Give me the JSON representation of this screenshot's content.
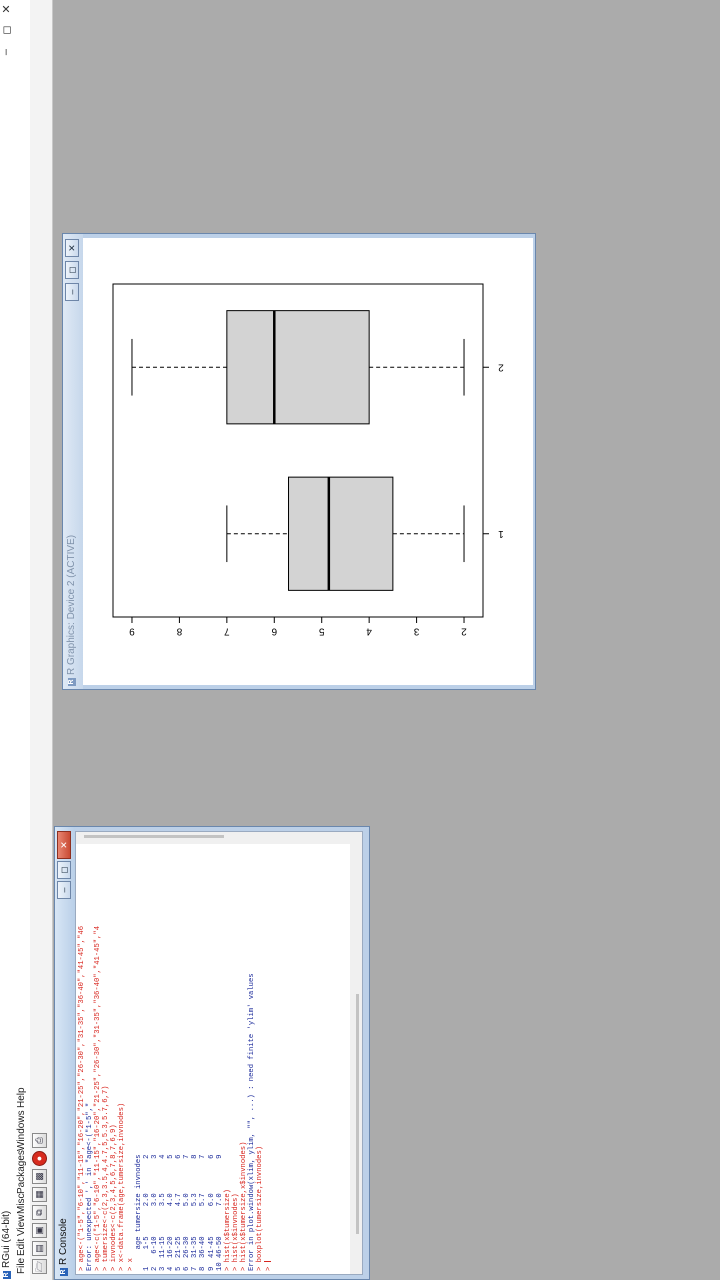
{
  "app": {
    "title": "RGui (64-bit)",
    "logo": "R",
    "controls": {
      "minimize": "–",
      "restore": "◻",
      "close": "✕"
    }
  },
  "menu": [
    "File",
    "Edit",
    "View",
    "Misc",
    "Packages",
    "Windows",
    "Help"
  ],
  "toolbar": [
    {
      "name": "open-script-icon",
      "glyph": "🗁"
    },
    {
      "name": "load-workspace-icon",
      "glyph": "▤"
    },
    {
      "name": "save-workspace-icon",
      "glyph": "▣"
    },
    {
      "name": "copy-icon",
      "glyph": "⧉"
    },
    {
      "name": "paste-icon",
      "glyph": "▦"
    },
    {
      "name": "copy-paste-icon",
      "glyph": "▩"
    },
    {
      "name": "stop-icon",
      "glyph": "●"
    },
    {
      "name": "print-icon",
      "glyph": "⎙"
    }
  ],
  "console": {
    "title": "R Console",
    "icon": "R",
    "lines": [
      {
        "t": "cmd",
        "s": "> age<-(\"1-5\",\"6-10\",\"11-15\",\"16-20\",\"21-25\",\"26-30\",\"31-35\",\"36-40\",\"41-45\",\"46"
      },
      {
        "t": "err",
        "s": "Error: unexpected ',' in \"age<-(\"1-5\",\""
      },
      {
        "t": "cmd",
        "s": "> age<-c(\"1-5\",\"6-10\",\"11-15\",\"16-20\",\"21-25\",\"26-30\",\"31-35\",\"36-40\",\"41-45\",\"4"
      },
      {
        "t": "cmd",
        "s": "> tumersize<-c(2,3,3.5,4,4.7,5,5.3,5.7,6,7)"
      },
      {
        "t": "cmd",
        "s": "> invnodes<-c(2,3,4,5,6,7,8,7,6,9)"
      },
      {
        "t": "cmd",
        "s": "> x<-data.frame(age,tumersize,invnodes)"
      },
      {
        "t": "cmd",
        "s": "> x"
      },
      {
        "t": "out",
        "s": "     age tumersize invnodes"
      },
      {
        "t": "out",
        "s": "1    1-5       2.0        2"
      },
      {
        "t": "out",
        "s": "2   6-10       3.0        3"
      },
      {
        "t": "out",
        "s": "3  11-15       3.5        4"
      },
      {
        "t": "out",
        "s": "4  16-20       4.0        5"
      },
      {
        "t": "out",
        "s": "5  21-25       4.7        6"
      },
      {
        "t": "out",
        "s": "6  26-30       5.0        7"
      },
      {
        "t": "out",
        "s": "7  31-35       5.3        8"
      },
      {
        "t": "out",
        "s": "8  36-40       5.7        7"
      },
      {
        "t": "out",
        "s": "9  41-45       6.0        6"
      },
      {
        "t": "out",
        "s": "10 46-50       7.0        9"
      },
      {
        "t": "cmd",
        "s": "> hist(x$tumersize)"
      },
      {
        "t": "cmd",
        "s": "> hist(x$invnodes)"
      },
      {
        "t": "cmd",
        "s": "> hist(x$tumersize,x$invnodes)"
      },
      {
        "t": "err",
        "s": "Error in plot.window(xlim, ylim, \"\", ...) : need finite 'ylim' values"
      },
      {
        "t": "cmd",
        "s": "> boxplot(tumersize,invnodes)"
      },
      {
        "t": "cmd",
        "s": "> "
      }
    ]
  },
  "graphics": {
    "title": "R Graphics: Device 2 (ACTIVE)",
    "icon": "R",
    "controls": {
      "minimize": "–",
      "restore": "◻",
      "close": "✕"
    }
  },
  "chart_data": {
    "type": "boxplot",
    "categories": [
      "1",
      "2"
    ],
    "boxes": [
      {
        "label": "1",
        "min": 2.0,
        "q1": 3.5,
        "median": 4.85,
        "q3": 5.7,
        "max": 7.0
      },
      {
        "label": "2",
        "min": 2.0,
        "q1": 4.0,
        "median": 6.0,
        "q3": 7.0,
        "max": 9.0
      }
    ],
    "yticks": [
      2,
      3,
      4,
      5,
      6,
      7,
      8,
      9
    ],
    "ylim": [
      1.6,
      9.4
    ],
    "title": "",
    "xlabel": "",
    "ylabel": "",
    "box_fill": "#d3d3d3",
    "grid": false
  }
}
